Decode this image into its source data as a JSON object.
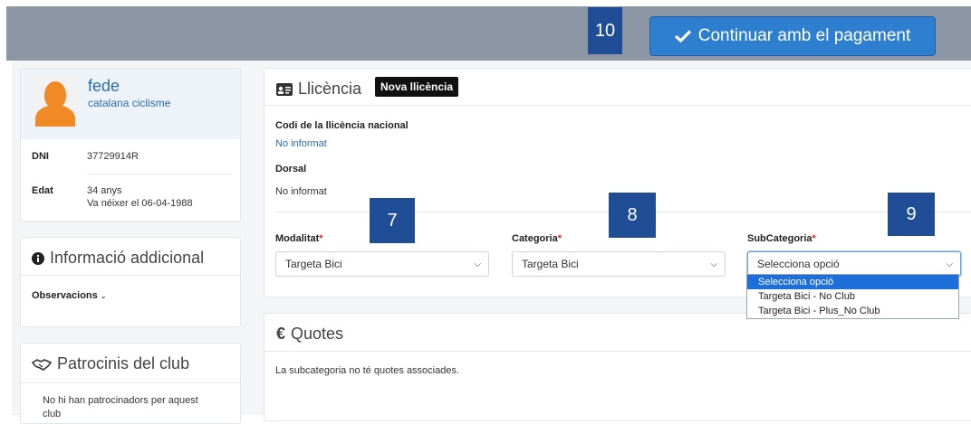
{
  "header": {
    "step_10": "10",
    "pay_button_label": "Continuar amb el pagament"
  },
  "profile": {
    "name": "fede",
    "club": "catalana ciclisme",
    "dni_label": "DNI",
    "dni_value": "37729914R",
    "age_label": "Edat",
    "age_value": "34 anys",
    "birth_value": "Va néixer el 06-04-1988"
  },
  "info": {
    "title": "Informació addicional",
    "observations_label": "Observacions"
  },
  "sponsors": {
    "title": "Patrocinis del club",
    "empty_text": "No hi han patrocinadors per aquest club"
  },
  "licence": {
    "title": "Llicència",
    "new_badge": "Nova llicència",
    "national_code_label": "Codi de la llicència nacional",
    "national_code_value": "No informat",
    "dorsal_label": "Dorsal",
    "dorsal_value": "No informat",
    "step_7": "7",
    "step_8": "8",
    "step_9": "9",
    "modalitat_label": "Modalitat",
    "modalitat_value": "Targeta Bici",
    "categoria_label": "Categoria",
    "categoria_value": "Targeta Bici",
    "subcategoria_label": "SubCategoria",
    "subcategoria_value": "Selecciona opció",
    "subcategoria_options": [
      "Selecciona opció",
      "Targeta Bici - No Club",
      "Targeta Bici - Plus_No Club"
    ]
  },
  "quotes": {
    "title": "Quotes",
    "empty_text": "La subcategoria no té quotes associades."
  }
}
